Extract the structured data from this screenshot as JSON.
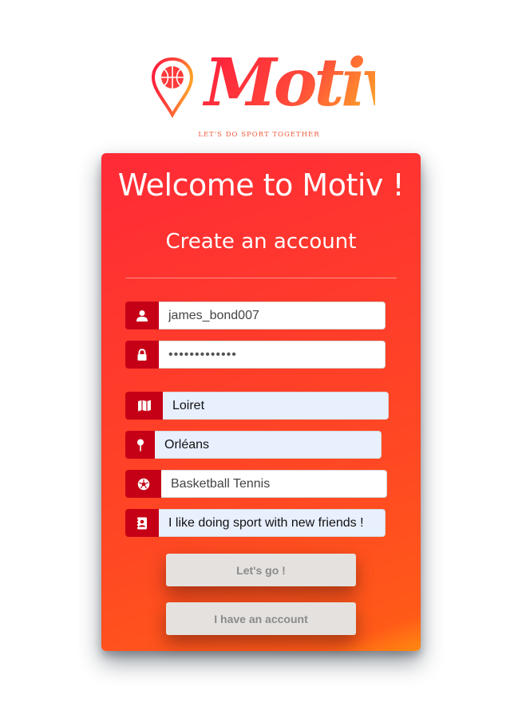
{
  "brand": {
    "logo_text": "Motiv",
    "tagline": "LET'S DO SPORT TOGETHER",
    "colors": {
      "gradient_start": "#ff1a3c",
      "gradient_end": "#ff9a2a",
      "icon_red": "#c50016"
    }
  },
  "card": {
    "welcome": "Welcome to Motiv !",
    "subtitle": "Create an account"
  },
  "form": {
    "username": {
      "icon": "user-icon",
      "value": "james_bond007"
    },
    "password": {
      "icon": "lock-icon",
      "value": "•••••••••••••"
    },
    "region": {
      "icon": "map-icon",
      "value": "Loiret"
    },
    "city": {
      "icon": "map-pin-icon",
      "value": "Orléans"
    },
    "sports": {
      "icon": "soccer-ball-icon",
      "value": "Basketball Tennis"
    },
    "bio": {
      "icon": "contact-card-icon",
      "value": "I like doing sport with new friends !"
    }
  },
  "buttons": {
    "submit": "Let's go !",
    "login": "I have an account"
  }
}
